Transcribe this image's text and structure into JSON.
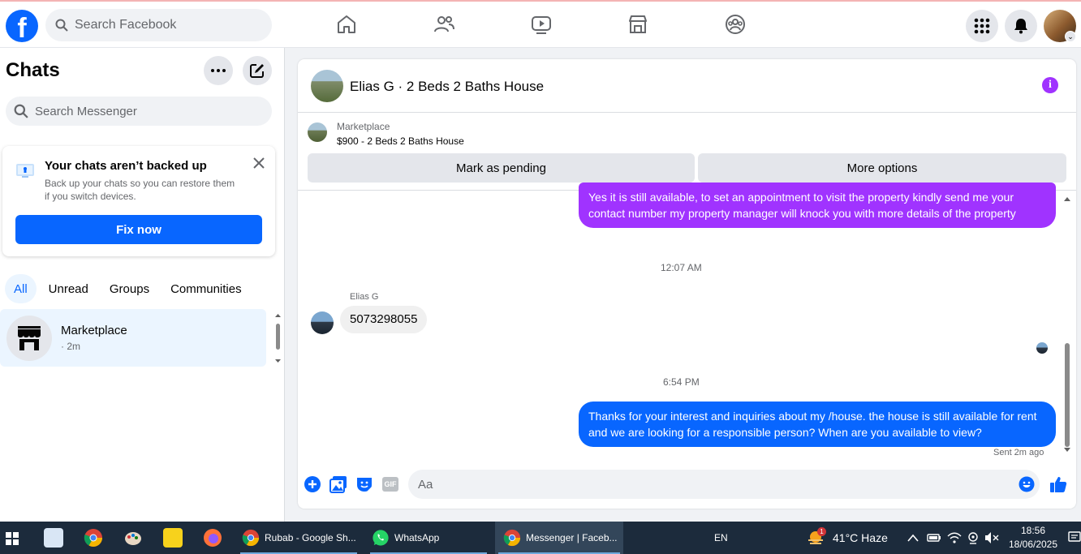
{
  "topnav": {
    "logo": "f",
    "search_placeholder": "Search Facebook",
    "icons": [
      "home-icon",
      "friends-icon",
      "video-icon",
      "marketplace-icon",
      "groups-icon"
    ],
    "right_icons": [
      "menu-grid-icon",
      "bell-icon",
      "profile-avatar"
    ]
  },
  "left": {
    "title": "Chats",
    "search_placeholder": "Search Messenger",
    "backup": {
      "title": "Your chats aren’t backed up",
      "description": "Back up your chats so you can restore them if you switch devices.",
      "button": "Fix now"
    },
    "filters": [
      "All",
      "Unread",
      "Groups",
      "Communities"
    ],
    "chat": {
      "name": "Marketplace",
      "time": "· 2m"
    }
  },
  "conversation": {
    "title": "Elias G · 2 Beds 2 Baths House",
    "marketplace_label": "Marketplace",
    "listing": "$900 - 2 Beds 2 Baths House",
    "buttons": {
      "pending": "Mark as pending",
      "more": "More options"
    },
    "messages": [
      {
        "type": "sent",
        "text": "Yes it is still available,  to set an appointment to visit the property kindly send me your contact number my property manager will knock you with more details of the property"
      },
      {
        "type": "time",
        "text": "12:07 AM"
      },
      {
        "type": "received",
        "sender": "Elias G",
        "text": "5073298055"
      },
      {
        "type": "time",
        "text": "6:54 PM"
      },
      {
        "type": "sent",
        "text": "Thanks for your interest and inquiries about my /house. the house is still available for rent and we are looking for a responsible person? When are you available to view?"
      }
    ],
    "status": "Sent 2m ago",
    "composer_placeholder": "Aa",
    "gif_label": "GIF"
  },
  "taskbar": {
    "items": [
      {
        "label": "Rubab - Google Sh..."
      },
      {
        "label": "WhatsApp"
      },
      {
        "label": "Messenger | Faceb..."
      }
    ],
    "language": "EN",
    "weather": "41°C  Haze",
    "weather_badge": "1",
    "time": "18:56",
    "date": "18/06/2025"
  },
  "colors": {
    "brand_blue": "#0866ff",
    "sent_purple": "#a033ff",
    "taskbar": "#1c2b3c"
  }
}
